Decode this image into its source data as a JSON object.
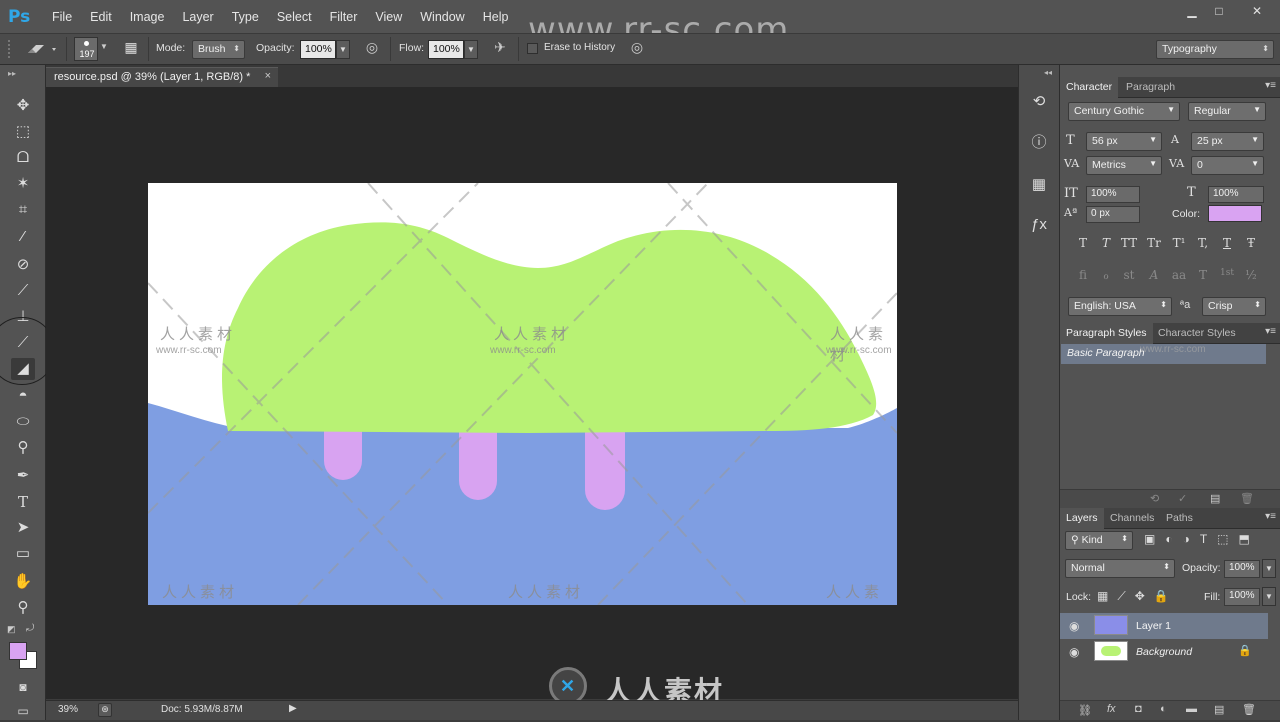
{
  "app": {
    "logo": "Ps",
    "watermark_url": "www.rr-sc.com",
    "watermark_brand": "人人素材",
    "watermark_brand_url": "www.rr-sc.com"
  },
  "menu": [
    "File",
    "Edit",
    "Image",
    "Layer",
    "Type",
    "Select",
    "Filter",
    "View",
    "Window",
    "Help"
  ],
  "window_controls": {
    "minimize": "▁",
    "maximize": "□",
    "close": "✕"
  },
  "options": {
    "brush_size": "197",
    "mode_label": "Mode:",
    "mode_value": "Brush",
    "opacity_label": "Opacity:",
    "opacity_value": "100%",
    "flow_label": "Flow:",
    "flow_value": "100%",
    "erase_history_label": "Erase to History",
    "workspace": "Typography"
  },
  "document": {
    "tab_title": "resource.psd @ 39% (Layer 1, RGB/8) *",
    "close": "×"
  },
  "status": {
    "zoom": "39%",
    "doc": "Doc: 5.93M/8.87M"
  },
  "character_panel": {
    "tabs": [
      "Character",
      "Paragraph"
    ],
    "font_family": "Century Gothic",
    "font_style": "Regular",
    "font_size": "56 px",
    "leading": "25 px",
    "kerning": "Metrics",
    "tracking": "0",
    "vertical_scale": "100%",
    "horizontal_scale": "100%",
    "baseline_shift": "0 px",
    "color_label": "Color:",
    "color_value": "#d9a3f2",
    "type_buttons": [
      "T",
      "T",
      "TT",
      "Tr",
      "T¹",
      "T,",
      "T",
      "Ŧ"
    ],
    "opentype_buttons": [
      "fi",
      "ℴ",
      "st",
      "A",
      "aa",
      "T",
      "1st",
      "½"
    ],
    "language": "English: USA",
    "aa_icon": "ªa",
    "antialias": "Crisp"
  },
  "paragraph_styles_panel": {
    "tabs": [
      "Paragraph Styles",
      "Character Styles"
    ],
    "items": [
      "Basic Paragraph"
    ]
  },
  "layers_panel": {
    "tabs": [
      "Layers",
      "Channels",
      "Paths"
    ],
    "filter_kind": "Kind",
    "blend_mode": "Normal",
    "opacity_label": "Opacity:",
    "opacity_value": "100%",
    "lock_label": "Lock:",
    "fill_label": "Fill:",
    "fill_value": "100%",
    "layers": [
      {
        "name": "Layer 1",
        "selected": true
      },
      {
        "name": "Background",
        "selected": false,
        "locked": true
      }
    ]
  },
  "colors": {
    "foreground": "#d9a3f2",
    "background": "#ffffff",
    "tree_green": "#b8f274",
    "water_blue": "#7f9ee2",
    "trunk_pink": "#d8a3f1",
    "accent_blue": "#2fa7e8"
  }
}
